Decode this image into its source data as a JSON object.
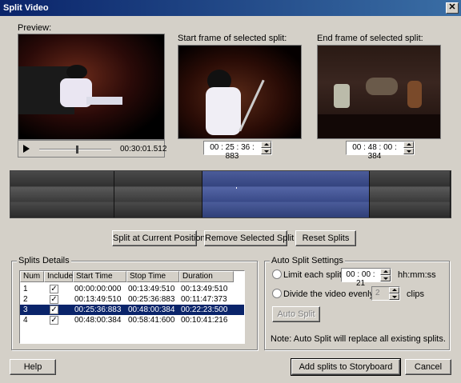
{
  "window": {
    "title": "Split Video",
    "close_glyph": "✕"
  },
  "preview": {
    "label": "Preview:",
    "time": "00:30:01.512",
    "seek_progress": 0.52
  },
  "start_frame": {
    "label": "Start frame of selected split:",
    "value": "00 : 25 : 36 : 883"
  },
  "end_frame": {
    "label": "End frame of selected split:",
    "value": "00 : 48 : 00 : 384"
  },
  "timeline": {
    "segment_fractions": [
      0.237,
      0.2,
      0.38,
      0.183
    ],
    "selected_index": 2
  },
  "actions": {
    "split_current": "Split at Current Position",
    "remove_selected": "Remove Selected Split",
    "reset": "Reset Splits"
  },
  "splits": {
    "title": "Splits Details",
    "columns": [
      "Num",
      "Include",
      "Start Time",
      "Stop Time",
      "Duration"
    ],
    "rows": [
      {
        "num": "1",
        "include": true,
        "start": "00:00:00:000",
        "stop": "00:13:49:510",
        "duration": "00:13:49:510"
      },
      {
        "num": "2",
        "include": true,
        "start": "00:13:49:510",
        "stop": "00:25:36:883",
        "duration": "00:11:47:373"
      },
      {
        "num": "3",
        "include": true,
        "start": "00:25:36:883",
        "stop": "00:48:00:384",
        "duration": "00:22:23:500"
      },
      {
        "num": "4",
        "include": true,
        "start": "00:48:00:384",
        "stop": "00:58:41:600",
        "duration": "00:10:41:216"
      }
    ],
    "selected_row": 2
  },
  "auto": {
    "title": "Auto Split Settings",
    "limit_label": "Limit each split to",
    "limit_value": "00 : 00 : 21",
    "limit_unit": "hh:mm:ss",
    "divide_label": "Divide the video evenly into",
    "divide_value": "2",
    "divide_unit": "clips",
    "button": "Auto Split",
    "note": "Note:  Auto Split will replace all existing splits."
  },
  "footer": {
    "help": "Help",
    "add": "Add splits to Storyboard",
    "cancel": "Cancel"
  },
  "icons": {
    "play": "play-icon",
    "close": "close-icon",
    "check": "checkmark-icon"
  }
}
